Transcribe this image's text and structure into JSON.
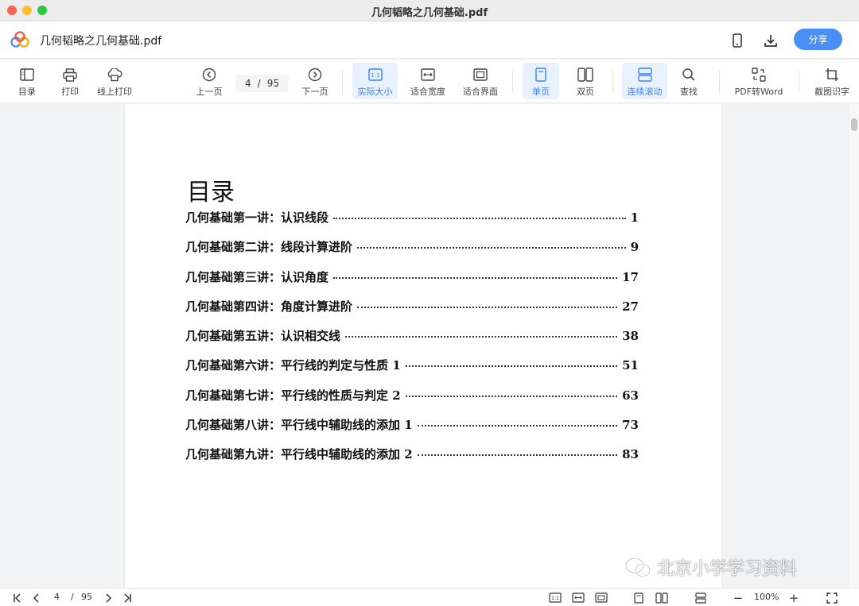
{
  "window": {
    "title": "几何韬略之几何基础.pdf"
  },
  "header": {
    "doc_title": "几何韬略之几何基础.pdf",
    "share_label": "分享",
    "mobile_icon": "mobile-icon",
    "download_icon": "download-icon"
  },
  "toolbar": {
    "toc": "目录",
    "print": "打印",
    "online_print": "线上打印",
    "prev": "上一页",
    "current_page": "4",
    "page_sep": "/",
    "total_pages": "95",
    "next": "下一页",
    "actual_size": "实际大小",
    "fit_width": "适合宽度",
    "fit_page": "适合界面",
    "single_page": "单页",
    "double_page": "双页",
    "continuous": "连续滚动",
    "find": "查找",
    "pdf_to_word": "PDF转Word",
    "ocr": "截图识字"
  },
  "document": {
    "heading": "目录",
    "entries": [
      {
        "title": "几何基础第一讲：认识线段",
        "page": "1"
      },
      {
        "title": "几何基础第二讲：线段计算进阶",
        "page": "9"
      },
      {
        "title": "几何基础第三讲：认识角度",
        "page": "17"
      },
      {
        "title": "几何基础第四讲：角度计算进阶",
        "page": "27"
      },
      {
        "title": "几何基础第五讲：认识相交线",
        "page": "38"
      },
      {
        "title": "几何基础第六讲：平行线的判定与性质 1",
        "page": "51"
      },
      {
        "title": "几何基础第七讲：平行线的性质与判定 2",
        "page": "63"
      },
      {
        "title": "几何基础第八讲：平行线中辅助线的添加 1",
        "page": "73"
      },
      {
        "title": "几何基础第九讲：平行线中辅助线的添加 2",
        "page": "83"
      }
    ]
  },
  "watermark": {
    "text": "北京小学学习资料"
  },
  "statusbar": {
    "current_page": "4",
    "page_sep": "/",
    "total_pages": "95",
    "zoom": "100%",
    "zoom_out": "−",
    "zoom_in": "+"
  },
  "colors": {
    "accent": "#4a90f4",
    "active_bg": "#e8f1fe",
    "active_text": "#3b82f6"
  }
}
